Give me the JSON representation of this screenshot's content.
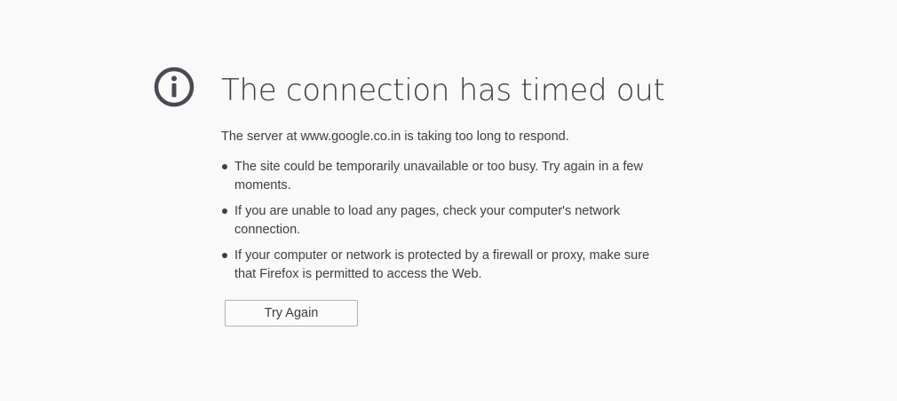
{
  "page": {
    "title": "The connection has timed out",
    "icon": "info-icon",
    "short_desc": "The server at www.google.co.in is taking too long to respond.",
    "suggestions": [
      "The site could be temporarily unavailable or too busy. Try again in a few moments.",
      "If you are unable to load any pages, check your computer's network connection.",
      "If your computer or network is protected by a firewall or proxy, make sure that Firefox is permitted to access the Web."
    ],
    "try_again_label": "Try Again"
  },
  "colors": {
    "background": "#f9f9fa",
    "text": "#3d3d44",
    "icon": "#4a4a52",
    "button_border": "#b1b1b3"
  }
}
